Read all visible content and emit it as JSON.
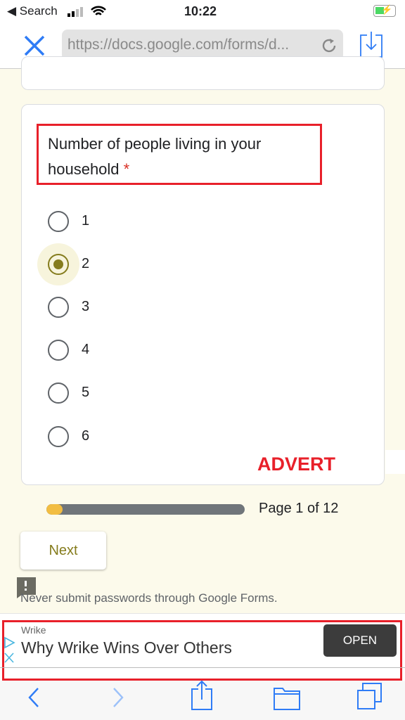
{
  "status_bar": {
    "back_label": "◀ Search",
    "time": "10:22"
  },
  "browser": {
    "url": "https://docs.google.com/forms/d...",
    "icons": [
      "close-icon",
      "reload-icon",
      "download-icon"
    ]
  },
  "question": {
    "title": "Number of people living in your household",
    "required_mark": "*",
    "options": [
      "1",
      "2",
      "3",
      "4",
      "5",
      "6"
    ],
    "selected": "2"
  },
  "advert_label": "ADVERT",
  "progress": {
    "text": "Page 1 of 12",
    "fraction": 0.083,
    "fill_color": "#f2bd42",
    "track_color": "#70757a"
  },
  "next_label": "Next",
  "warning": "Never submit passwords through Google Forms.",
  "ad": {
    "brand": "Wrike",
    "headline": "Why Wrike Wins Over Others",
    "button": "OPEN"
  },
  "accent": "#857c1d"
}
